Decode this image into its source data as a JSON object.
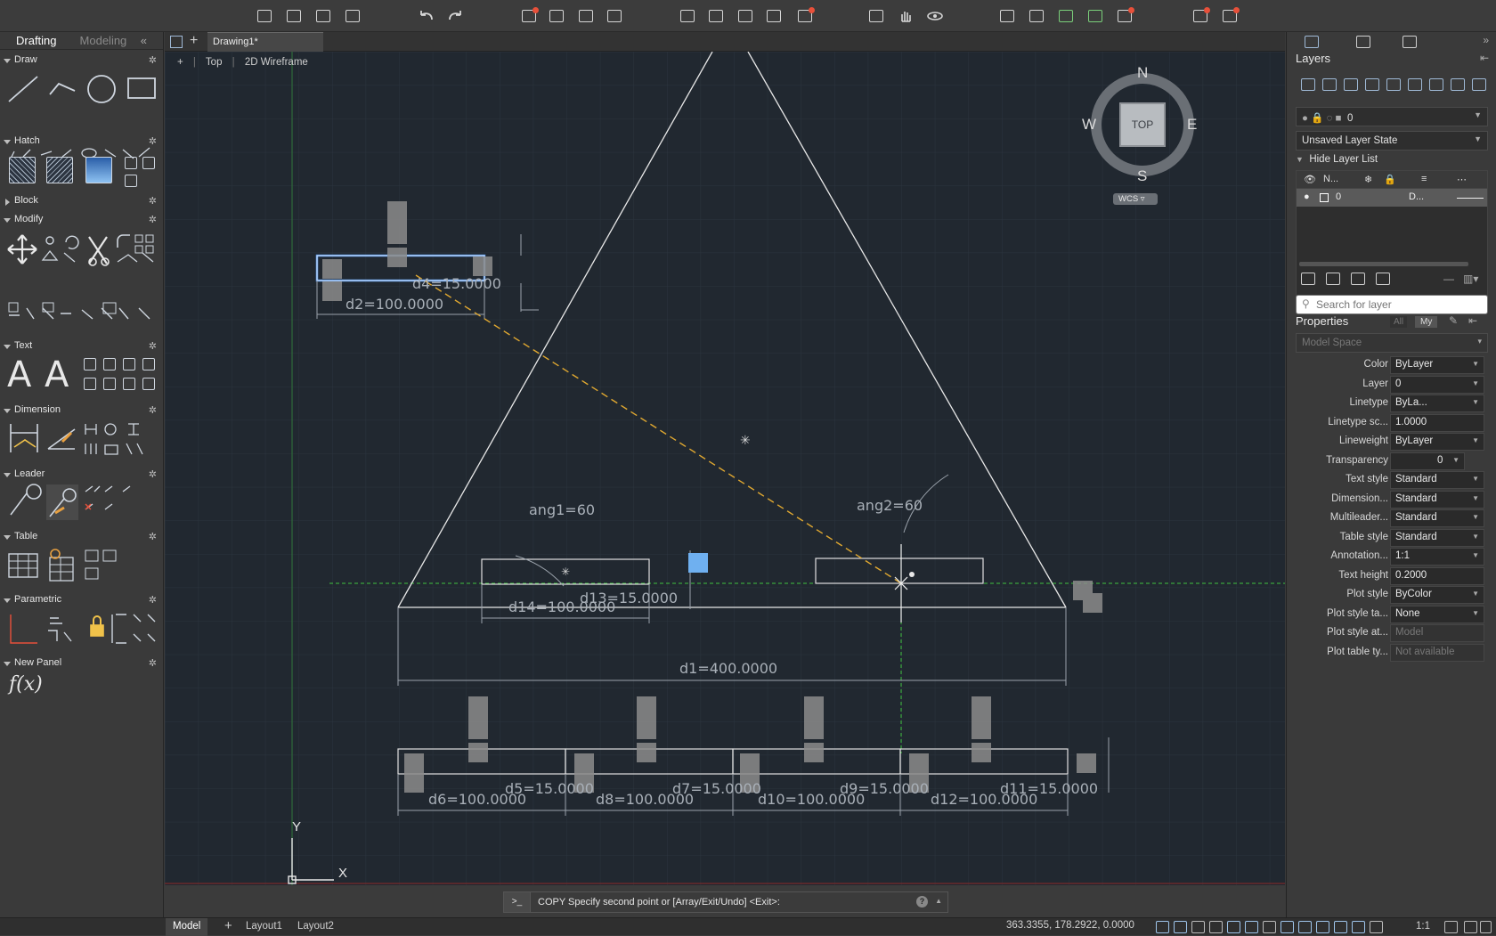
{
  "workspace": {
    "drafting": "Drafting",
    "modeling": "Modeling"
  },
  "panels": {
    "draw": "Draw",
    "hatch": "Hatch",
    "block": "Block",
    "modify": "Modify",
    "text": "Text",
    "dimension": "Dimension",
    "leader": "Leader",
    "table": "Table",
    "parametric": "Parametric",
    "newpanel": "New Panel",
    "fx": "f(x)"
  },
  "document": {
    "tab": "Drawing1*"
  },
  "viewport": {
    "plus": "+",
    "view": "Top",
    "style": "2D Wireframe"
  },
  "viewcube": {
    "n": "N",
    "s": "S",
    "e": "E",
    "w": "W",
    "top": "TOP",
    "wcs": "WCS"
  },
  "drawing": {
    "dims": {
      "d1": "d1=400.0000",
      "d2": "d2=100.0000",
      "d4": "d4=15.0000",
      "d5": "d5=15.0000",
      "d6": "d6=100.0000",
      "d7": "d7=15.0000",
      "d8": "d8=100.0000",
      "d9": "d9=15.0000",
      "d10": "d10=100.0000",
      "d11": "d11=15.0000",
      "d12": "d12=100.0000",
      "d13": "d13=15.0000",
      "d14": "d14=100.0000",
      "ang1": "ang1=60",
      "ang2": "ang2=60"
    },
    "ucs": {
      "x": "X",
      "y": "Y"
    }
  },
  "command": {
    "prompt": ">_",
    "text": "COPY Specify second point or [Array/Exit/Undo] <Exit>:",
    "help": "?"
  },
  "status": {
    "model": "Model",
    "layout1": "Layout1",
    "layout2": "Layout2",
    "coords": "363.3355, 178.2922, 0.0000",
    "scale": "1:1"
  },
  "layers": {
    "title": "Layers",
    "current_layer": "0",
    "layer_state": "Unsaved Layer State",
    "hide_list": "Hide Layer List",
    "col_name": "N...",
    "row_name": "0",
    "row_desc": "D...",
    "search_placeholder": "Search for layer"
  },
  "properties": {
    "title": "Properties",
    "all": "All",
    "my": "My",
    "space": "Model Space",
    "rows": [
      {
        "label": "Color",
        "value": "ByLayer"
      },
      {
        "label": "Layer",
        "value": "0"
      },
      {
        "label": "Linetype",
        "value": "ByLa..."
      },
      {
        "label": "Linetype sc...",
        "value": "1.0000"
      },
      {
        "label": "Lineweight",
        "value": "ByLayer"
      },
      {
        "label": "Transparency",
        "value": "0"
      },
      {
        "label": "Text style",
        "value": "Standard"
      },
      {
        "label": "Dimension...",
        "value": "Standard"
      },
      {
        "label": "Multileader...",
        "value": "Standard"
      },
      {
        "label": "Table style",
        "value": "Standard"
      },
      {
        "label": "Annotation...",
        "value": "1:1"
      },
      {
        "label": "Text height",
        "value": "0.2000"
      },
      {
        "label": "Plot style",
        "value": "ByColor"
      },
      {
        "label": "Plot style ta...",
        "value": "None"
      },
      {
        "label": "Plot style at...",
        "value": "Model"
      },
      {
        "label": "Plot table ty...",
        "value": "Not available"
      }
    ]
  },
  "colors": {
    "accent": "#4a90d9",
    "background": "#212830"
  }
}
